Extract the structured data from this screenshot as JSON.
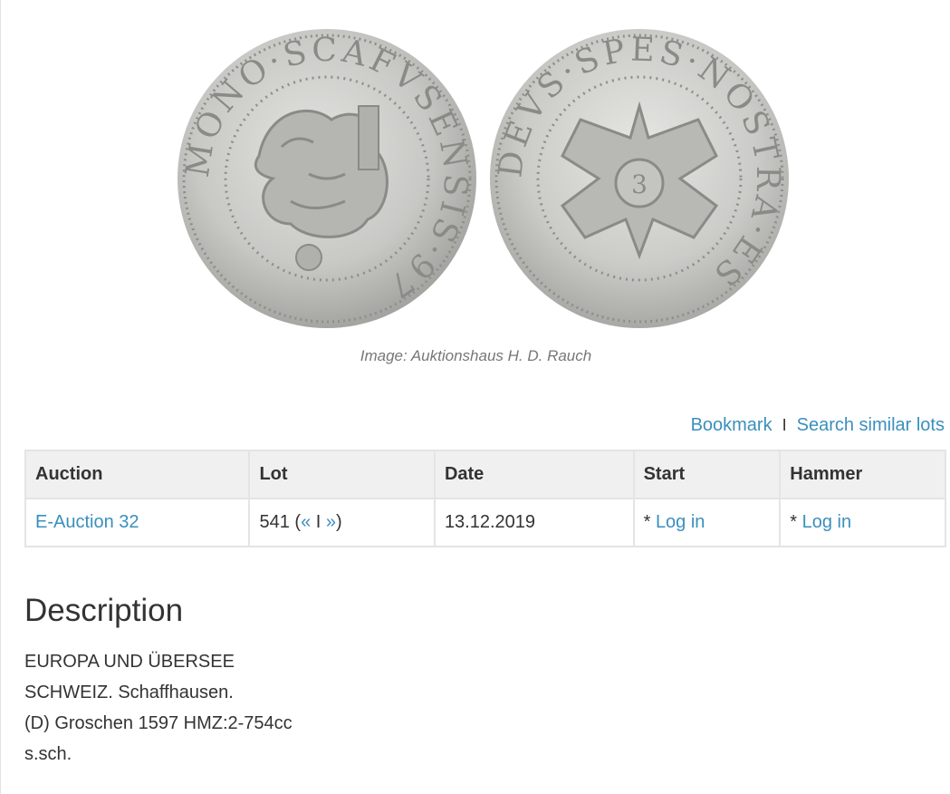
{
  "image": {
    "alt": "Groschen 1597 Schaffhausen coin, obverse and reverse",
    "obverse_legend": "MONO·SCAFVSENSIS·97",
    "reverse_legend": "DEVS·SPES·NOSTRA·ES",
    "caption": "Image: Auktionshaus H. D. Rauch"
  },
  "actions": {
    "bookmark": "Bookmark",
    "separator": "I",
    "search_similar": "Search similar lots"
  },
  "table": {
    "headers": {
      "auction": "Auction",
      "lot": "Lot",
      "date": "Date",
      "start": "Start",
      "hammer": "Hammer"
    },
    "row": {
      "auction": "E-Auction 32",
      "lot_number": "541",
      "prev": "«",
      "nav_sep": "I",
      "next": "»",
      "date": "13.12.2019",
      "start_prefix": "* ",
      "start_link": "Log in",
      "hammer_prefix": "* ",
      "hammer_link": "Log in"
    }
  },
  "description": {
    "title": "Description",
    "lines": [
      "EUROPA UND ÜBERSEE",
      "SCHWEIZ. Schaffhausen.",
      "(D) Groschen 1597 HMZ:2-754cc",
      "s.sch."
    ]
  },
  "colors": {
    "link": "#3a8fbd",
    "text": "#333333",
    "header_bg": "#f0f0f0",
    "border": "#e4e4e4",
    "coin_silver": "#c9c9c7"
  }
}
